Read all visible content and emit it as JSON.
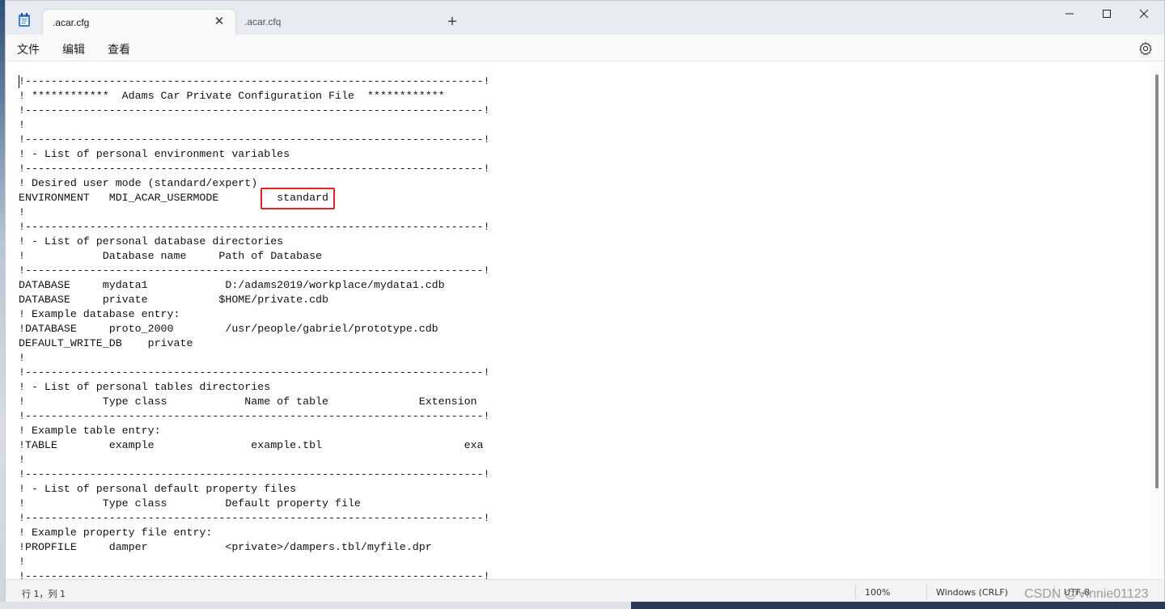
{
  "window": {
    "tabs": [
      {
        "label": ".acar.cfg",
        "active": true
      },
      {
        "label": ".acar.cfq",
        "active": false
      }
    ]
  },
  "menu": {
    "file": "文件",
    "edit": "编辑",
    "view": "查看"
  },
  "editor": {
    "content": "!-----------------------------------------------------------------------!\n! ************  Adams Car Private Configuration File  ************\n!-----------------------------------------------------------------------!\n!\n!-----------------------------------------------------------------------!\n! - List of personal environment variables\n!-----------------------------------------------------------------------!\n! Desired user mode (standard/expert)\nENVIRONMENT   MDI_ACAR_USERMODE         standard\n!\n!-----------------------------------------------------------------------!\n! - List of personal database directories\n!            Database name     Path of Database\n!-----------------------------------------------------------------------!\nDATABASE     mydata1            D:/adams2019/workplace/mydata1.cdb\nDATABASE     private           $HOME/private.cdb\n! Example database entry:\n!DATABASE     proto_2000        /usr/people/gabriel/prototype.cdb\nDEFAULT_WRITE_DB    private\n!\n!-----------------------------------------------------------------------!\n! - List of personal tables directories\n!            Type class            Name of table              Extension\n!-----------------------------------------------------------------------!\n! Example table entry:\n!TABLE        example               example.tbl                      exa\n!\n!-----------------------------------------------------------------------!\n! - List of personal default property files\n!            Type class         Default property file\n!-----------------------------------------------------------------------!\n! Example property file entry:\n!PROPFILE     damper            <private>/dampers.tbl/myfile.dpr\n!\n!-----------------------------------------------------------------------!"
  },
  "statusbar": {
    "position": "行 1，列 1",
    "zoom": "100%",
    "line_ending": "Windows (CRLF)",
    "encoding": "UTF-8"
  },
  "watermark": "CSDN @Vinnie01123",
  "colors": {
    "highlight": "#e0261f",
    "titlebar": "#e8ecf2"
  }
}
